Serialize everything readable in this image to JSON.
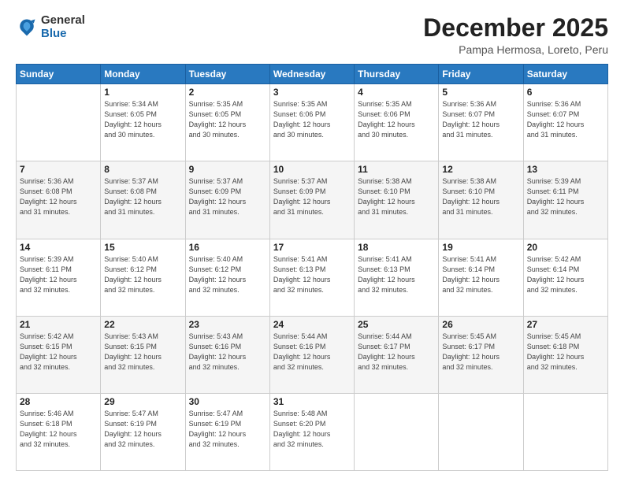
{
  "logo": {
    "general": "General",
    "blue": "Blue"
  },
  "header": {
    "month": "December 2025",
    "location": "Pampa Hermosa, Loreto, Peru"
  },
  "weekdays": [
    "Sunday",
    "Monday",
    "Tuesday",
    "Wednesday",
    "Thursday",
    "Friday",
    "Saturday"
  ],
  "weeks": [
    [
      {
        "day": "",
        "info": ""
      },
      {
        "day": "1",
        "info": "Sunrise: 5:34 AM\nSunset: 6:05 PM\nDaylight: 12 hours\nand 30 minutes."
      },
      {
        "day": "2",
        "info": "Sunrise: 5:35 AM\nSunset: 6:05 PM\nDaylight: 12 hours\nand 30 minutes."
      },
      {
        "day": "3",
        "info": "Sunrise: 5:35 AM\nSunset: 6:06 PM\nDaylight: 12 hours\nand 30 minutes."
      },
      {
        "day": "4",
        "info": "Sunrise: 5:35 AM\nSunset: 6:06 PM\nDaylight: 12 hours\nand 30 minutes."
      },
      {
        "day": "5",
        "info": "Sunrise: 5:36 AM\nSunset: 6:07 PM\nDaylight: 12 hours\nand 31 minutes."
      },
      {
        "day": "6",
        "info": "Sunrise: 5:36 AM\nSunset: 6:07 PM\nDaylight: 12 hours\nand 31 minutes."
      }
    ],
    [
      {
        "day": "7",
        "info": "Sunrise: 5:36 AM\nSunset: 6:08 PM\nDaylight: 12 hours\nand 31 minutes."
      },
      {
        "day": "8",
        "info": "Sunrise: 5:37 AM\nSunset: 6:08 PM\nDaylight: 12 hours\nand 31 minutes."
      },
      {
        "day": "9",
        "info": "Sunrise: 5:37 AM\nSunset: 6:09 PM\nDaylight: 12 hours\nand 31 minutes."
      },
      {
        "day": "10",
        "info": "Sunrise: 5:37 AM\nSunset: 6:09 PM\nDaylight: 12 hours\nand 31 minutes."
      },
      {
        "day": "11",
        "info": "Sunrise: 5:38 AM\nSunset: 6:10 PM\nDaylight: 12 hours\nand 31 minutes."
      },
      {
        "day": "12",
        "info": "Sunrise: 5:38 AM\nSunset: 6:10 PM\nDaylight: 12 hours\nand 31 minutes."
      },
      {
        "day": "13",
        "info": "Sunrise: 5:39 AM\nSunset: 6:11 PM\nDaylight: 12 hours\nand 32 minutes."
      }
    ],
    [
      {
        "day": "14",
        "info": "Sunrise: 5:39 AM\nSunset: 6:11 PM\nDaylight: 12 hours\nand 32 minutes."
      },
      {
        "day": "15",
        "info": "Sunrise: 5:40 AM\nSunset: 6:12 PM\nDaylight: 12 hours\nand 32 minutes."
      },
      {
        "day": "16",
        "info": "Sunrise: 5:40 AM\nSunset: 6:12 PM\nDaylight: 12 hours\nand 32 minutes."
      },
      {
        "day": "17",
        "info": "Sunrise: 5:41 AM\nSunset: 6:13 PM\nDaylight: 12 hours\nand 32 minutes."
      },
      {
        "day": "18",
        "info": "Sunrise: 5:41 AM\nSunset: 6:13 PM\nDaylight: 12 hours\nand 32 minutes."
      },
      {
        "day": "19",
        "info": "Sunrise: 5:41 AM\nSunset: 6:14 PM\nDaylight: 12 hours\nand 32 minutes."
      },
      {
        "day": "20",
        "info": "Sunrise: 5:42 AM\nSunset: 6:14 PM\nDaylight: 12 hours\nand 32 minutes."
      }
    ],
    [
      {
        "day": "21",
        "info": "Sunrise: 5:42 AM\nSunset: 6:15 PM\nDaylight: 12 hours\nand 32 minutes."
      },
      {
        "day": "22",
        "info": "Sunrise: 5:43 AM\nSunset: 6:15 PM\nDaylight: 12 hours\nand 32 minutes."
      },
      {
        "day": "23",
        "info": "Sunrise: 5:43 AM\nSunset: 6:16 PM\nDaylight: 12 hours\nand 32 minutes."
      },
      {
        "day": "24",
        "info": "Sunrise: 5:44 AM\nSunset: 6:16 PM\nDaylight: 12 hours\nand 32 minutes."
      },
      {
        "day": "25",
        "info": "Sunrise: 5:44 AM\nSunset: 6:17 PM\nDaylight: 12 hours\nand 32 minutes."
      },
      {
        "day": "26",
        "info": "Sunrise: 5:45 AM\nSunset: 6:17 PM\nDaylight: 12 hours\nand 32 minutes."
      },
      {
        "day": "27",
        "info": "Sunrise: 5:45 AM\nSunset: 6:18 PM\nDaylight: 12 hours\nand 32 minutes."
      }
    ],
    [
      {
        "day": "28",
        "info": "Sunrise: 5:46 AM\nSunset: 6:18 PM\nDaylight: 12 hours\nand 32 minutes."
      },
      {
        "day": "29",
        "info": "Sunrise: 5:47 AM\nSunset: 6:19 PM\nDaylight: 12 hours\nand 32 minutes."
      },
      {
        "day": "30",
        "info": "Sunrise: 5:47 AM\nSunset: 6:19 PM\nDaylight: 12 hours\nand 32 minutes."
      },
      {
        "day": "31",
        "info": "Sunrise: 5:48 AM\nSunset: 6:20 PM\nDaylight: 12 hours\nand 32 minutes."
      },
      {
        "day": "",
        "info": ""
      },
      {
        "day": "",
        "info": ""
      },
      {
        "day": "",
        "info": ""
      }
    ]
  ]
}
